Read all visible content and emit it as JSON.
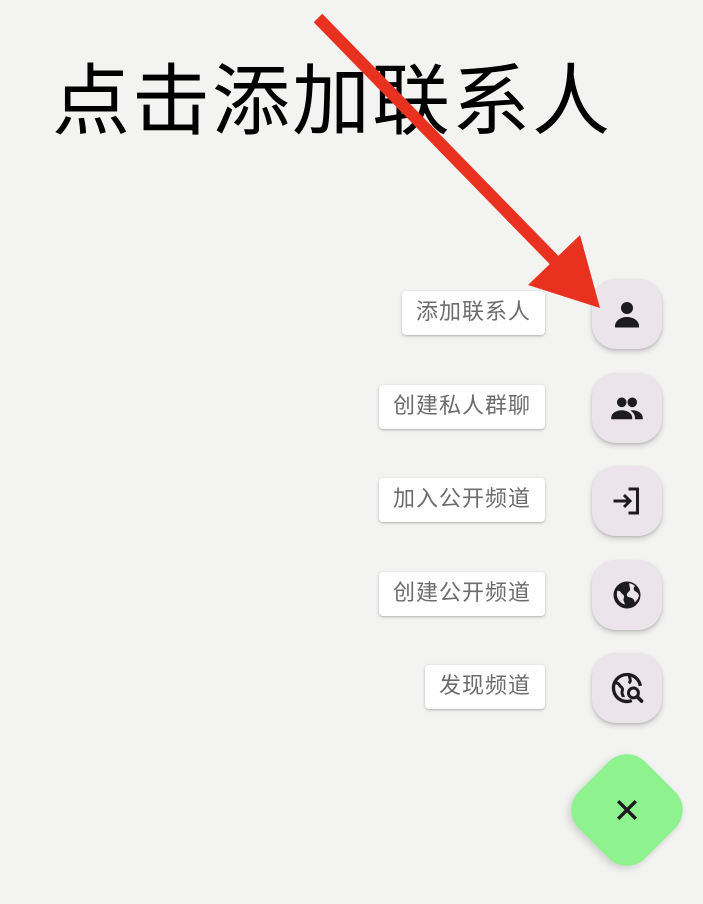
{
  "instruction": {
    "text": "点击添加联系人",
    "arrow_color": "#e8321f"
  },
  "fab_menu": {
    "items": [
      {
        "label": "添加联系人",
        "icon": "person-icon"
      },
      {
        "label": "创建私人群聊",
        "icon": "group-icon"
      },
      {
        "label": "加入公开频道",
        "icon": "login-icon"
      },
      {
        "label": "创建公开频道",
        "icon": "globe-icon"
      },
      {
        "label": "发现频道",
        "icon": "globe-search-icon"
      }
    ],
    "close_icon": "close-icon",
    "mini_fab_color": "#ebe4ea",
    "main_fab_color": "#8ef28f"
  }
}
